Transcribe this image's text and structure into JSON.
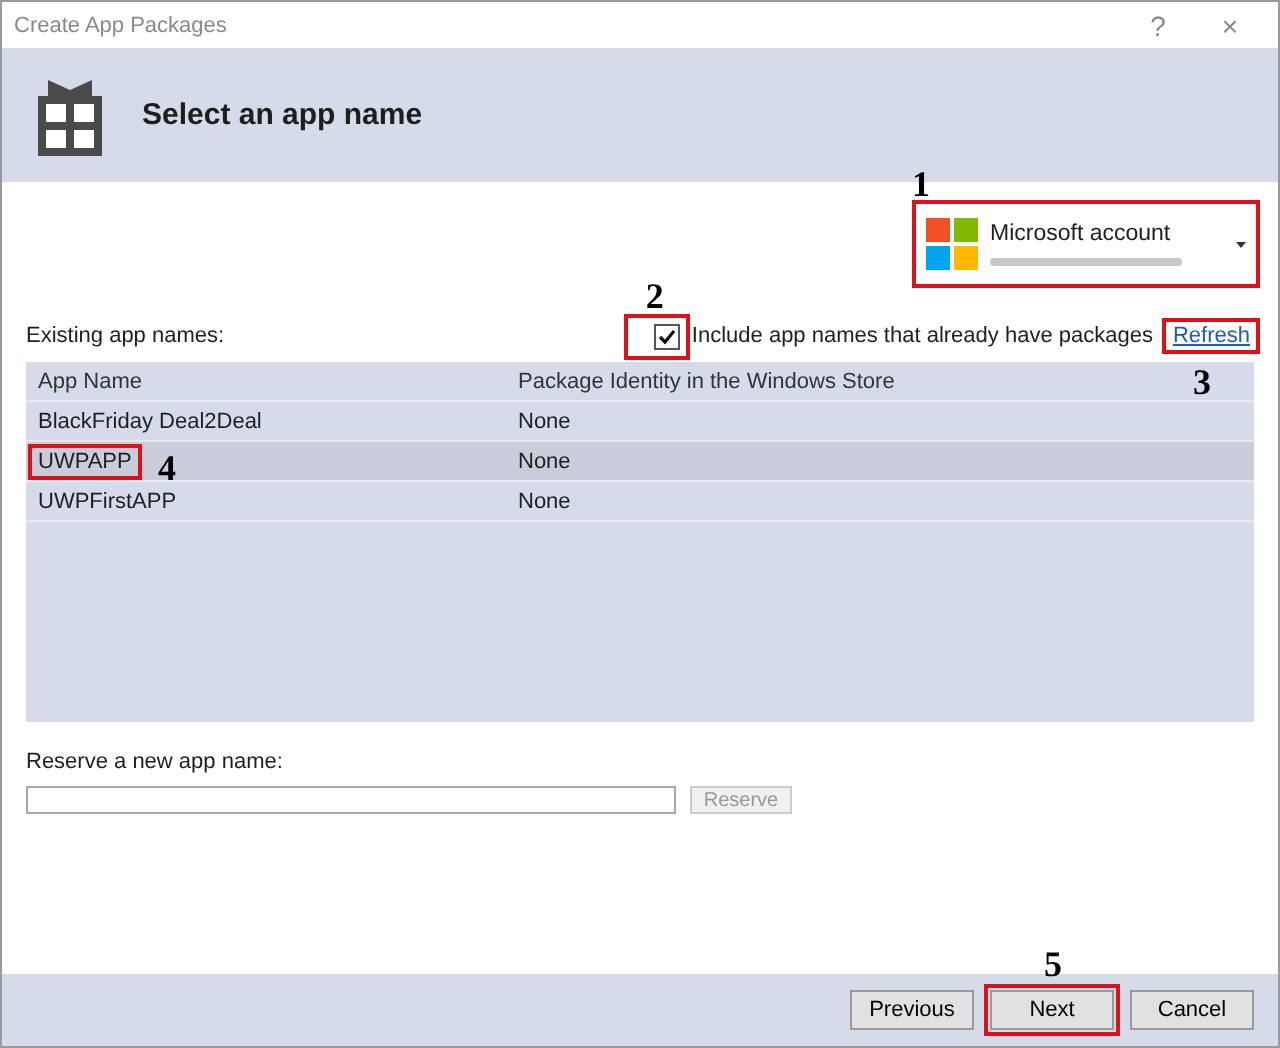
{
  "window": {
    "title": "Create App Packages",
    "help": "?",
    "close": "×"
  },
  "header": {
    "title": "Select an app name"
  },
  "account": {
    "name": "Microsoft account",
    "highlighted": true,
    "callout": "1"
  },
  "existing_label": "Existing app names:",
  "include_checkbox": {
    "label": "Include app names that already have packages",
    "checked": true,
    "highlighted": true,
    "callout": "2"
  },
  "refresh": {
    "label": "Refresh",
    "highlighted": true,
    "callout": "3"
  },
  "table": {
    "columns": [
      "App Name",
      "Package Identity in the Windows Store"
    ],
    "rows": [
      {
        "cells": [
          "BlackFriday Deal2Deal",
          "None"
        ],
        "selected": false
      },
      {
        "cells": [
          "UWPAPP",
          "None"
        ],
        "selected": true,
        "highlighted": true,
        "callout": "4"
      },
      {
        "cells": [
          "UWPFirstAPP",
          "None"
        ],
        "selected": false
      }
    ]
  },
  "reserve": {
    "label": "Reserve a new app name:",
    "button": "Reserve",
    "disabled": true
  },
  "footer": {
    "buttons": [
      {
        "label": "Previous"
      },
      {
        "label": "Next",
        "highlighted": true,
        "callout": "5"
      },
      {
        "label": "Cancel"
      }
    ]
  }
}
